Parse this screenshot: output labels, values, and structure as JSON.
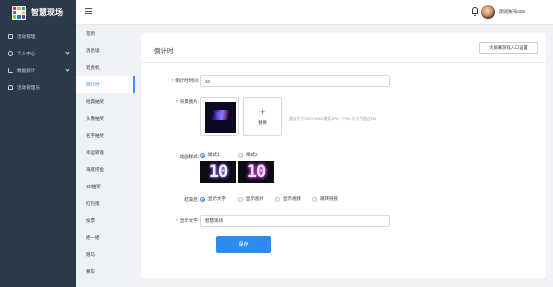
{
  "app": {
    "title": "智慧现场"
  },
  "sidebar": {
    "items": [
      {
        "label": "活动管理",
        "icon": "document-icon",
        "has_submenu": false
      },
      {
        "label": "个人中心",
        "icon": "user-icon",
        "has_submenu": true
      },
      {
        "label": "数据统计",
        "icon": "chart-icon",
        "has_submenu": true
      },
      {
        "label": "活动管理员",
        "icon": "group-icon",
        "has_submenu": false
      }
    ]
  },
  "topbar": {
    "username": "测试账号005"
  },
  "submenu": {
    "items": [
      "签到",
      "消息墙",
      "老虎机",
      "倒计时",
      "经典抽奖",
      "头像抽奖",
      "名字抽奖",
      "幸运转盘",
      "海底捞鱼",
      "3D抽奖",
      "红包雨",
      "投票",
      "摇一摇",
      "跑马",
      "赛车"
    ],
    "active_index": 3
  },
  "page": {
    "title": "倒计时",
    "entry_button": "大屏幕游戏入口设置"
  },
  "form": {
    "countdown": {
      "label": "倒计时时间:",
      "value": "10"
    },
    "background": {
      "label": "背景图片:",
      "replace_label": "替换",
      "hint": "建议尺寸1920*1080,格式JPG、PNG,大小不超过2M"
    },
    "animation": {
      "label": "动画样式:",
      "options": [
        "样式1",
        "样式2"
      ],
      "selected_index": 0,
      "preview_text": "10"
    },
    "end": {
      "label": "结束后:",
      "options": [
        "显示文字",
        "显示图片",
        "显示视频",
        "跳转链接"
      ],
      "selected_index": 0
    },
    "display_text": {
      "label": "显示文字:",
      "value": "智慧现场"
    },
    "save_label": "保存"
  },
  "colors": {
    "sidebar_bg": "#2b3a4a",
    "accent": "#2d8cf0",
    "required": "#f5222d"
  }
}
